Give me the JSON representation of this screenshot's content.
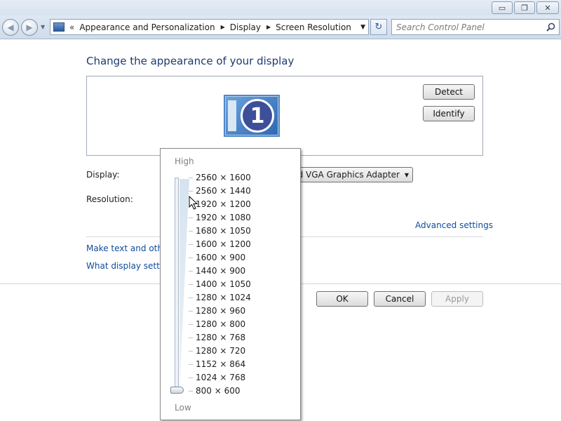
{
  "window": {
    "min_glyph": "▭",
    "max_glyph": "❐",
    "close_glyph": "✕"
  },
  "nav": {
    "back_glyph": "◀",
    "forward_glyph": "▶",
    "history_glyph": "▼",
    "address_chevron": "«",
    "breadcrumbs": [
      {
        "label": "Appearance and Personalization"
      },
      {
        "label": "Display"
      },
      {
        "label": "Screen Resolution"
      }
    ],
    "separator_glyph": "▶",
    "dropdown_glyph": "▼",
    "refresh_glyph": "↻",
    "search_placeholder": "Search Control Panel"
  },
  "main": {
    "title": "Change the appearance of your display",
    "monitor_number": "1",
    "detect_label": "Detect",
    "identify_label": "Identify",
    "display_label": "Display:",
    "display_value": "1. Standard VGA Graphics Adapter",
    "display_caret": "▼",
    "resolution_label": "Resolution:",
    "advanced_link": "Advanced settings",
    "make_text_link": "Make text and other",
    "what_settings_link": "What display setting",
    "ok_label": "OK",
    "cancel_label": "Cancel",
    "apply_label": "Apply"
  },
  "resolution_popup": {
    "high_label": "High",
    "low_label": "Low",
    "options": [
      "2560 × 1600",
      "2560 × 1440",
      "1920 × 1200",
      "1920 × 1080",
      "1680 × 1050",
      "1600 × 1200",
      "1600 × 900",
      "1440 × 900",
      "1400 × 1050",
      "1280 × 1024",
      "1280 × 960",
      "1280 × 800",
      "1280 × 768",
      "1280 × 720",
      "1152 × 864",
      "1024 × 768",
      "800 × 600"
    ],
    "selected": "800 × 600"
  },
  "colors": {
    "title_blue": "#1e3a6e",
    "link_blue": "#0f4c9b",
    "disabled_text": "#9a9a9a"
  }
}
